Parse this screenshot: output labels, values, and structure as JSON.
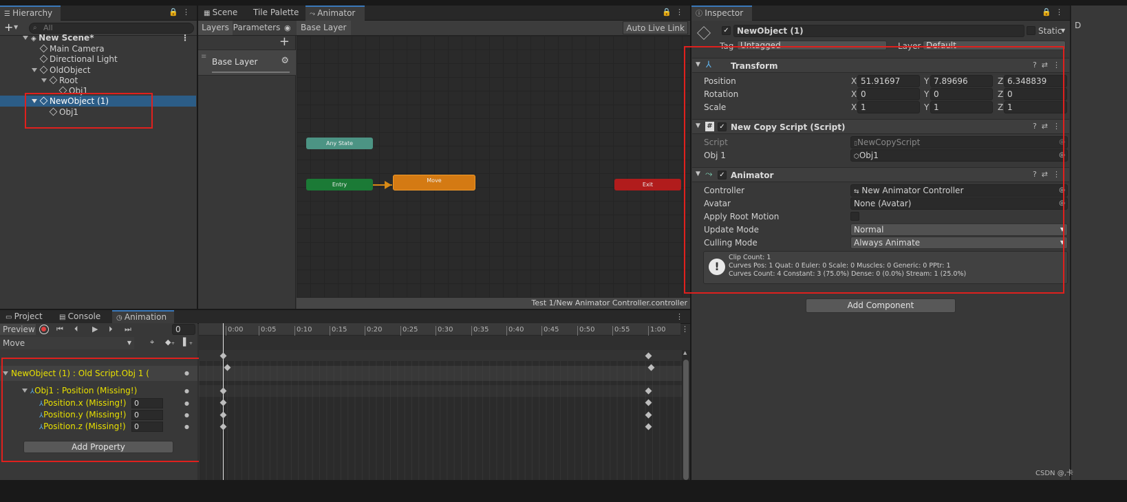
{
  "hierarchy": {
    "tab_label": "Hierarchy",
    "add_label": "+",
    "search_placeholder": "All",
    "items": [
      {
        "label": "New Scene*"
      },
      {
        "label": "Main Camera"
      },
      {
        "label": "Directional Light"
      },
      {
        "label": "OldObject"
      },
      {
        "label": "Root"
      },
      {
        "label": "Obj1"
      },
      {
        "label": "NewObject (1)"
      },
      {
        "label": "Obj1"
      }
    ]
  },
  "center": {
    "tabs": [
      "Scene",
      "Tile Palette",
      "Animator"
    ],
    "layers_tab": "Layers",
    "parameters_tab": "Parameters",
    "breadcrumb": "Base Layer",
    "auto_live_link": "Auto Live Link",
    "layer_item": "Base Layer",
    "nodes": {
      "any_state": "Any State",
      "entry": "Entry",
      "move": "Move",
      "exit": "Exit"
    },
    "status_path": "Test 1/New Animator Controller.controller"
  },
  "inspector": {
    "tab_label": "Inspector",
    "object_name": "NewObject (1)",
    "static_label": "Static",
    "tag_label": "Tag",
    "tag_value": "Untagged",
    "layer_label": "Layer",
    "layer_value": "Default",
    "transform": {
      "title": "Transform",
      "position_label": "Position",
      "rotation_label": "Rotation",
      "scale_label": "Scale",
      "position": {
        "x": "51.91697",
        "y": "7.89696",
        "z": "6.348839"
      },
      "rotation": {
        "x": "0",
        "y": "0",
        "z": "0"
      },
      "scale": {
        "x": "1",
        "y": "1",
        "z": "1"
      },
      "axis_x": "X",
      "axis_y": "Y",
      "axis_z": "Z"
    },
    "copy_script": {
      "title": "New Copy Script (Script)",
      "script_label": "Script",
      "script_value": "NewCopyScript",
      "obj_label": "Obj 1",
      "obj_value": "Obj1"
    },
    "animator": {
      "title": "Animator",
      "controller_label": "Controller",
      "controller_value": "New Animator Controller",
      "avatar_label": "Avatar",
      "avatar_value": "None (Avatar)",
      "root_motion_label": "Apply Root Motion",
      "update_mode_label": "Update Mode",
      "update_mode_value": "Normal",
      "culling_mode_label": "Culling Mode",
      "culling_mode_value": "Always Animate",
      "info_line1": "Clip Count: 1",
      "info_line2": "Curves Pos: 1 Quat: 0 Euler: 0 Scale: 0 Muscles: 0 Generic: 0 PPtr: 1",
      "info_line3": "Curves Count: 4 Constant: 3 (75.0%) Dense: 0 (0.0%) Stream: 1 (25.0%)"
    },
    "add_component": "Add Component"
  },
  "bottom": {
    "tabs": [
      "Project",
      "Console",
      "Animation"
    ],
    "preview": "Preview",
    "frame": "0",
    "clip": "Move",
    "ticks": [
      "0:00",
      "0:05",
      "0:10",
      "0:15",
      "0:20",
      "0:25",
      "0:30",
      "0:35",
      "0:40",
      "0:45",
      "0:50",
      "0:55",
      "1:00"
    ],
    "properties": [
      {
        "label": "NewObject (1) : Old Script.Obj 1 ("
      },
      {
        "label": "Obj1 : Position (Missing!)"
      },
      {
        "label": "Position.x (Missing!)",
        "value": "0"
      },
      {
        "label": "Position.y (Missing!)",
        "value": "0"
      },
      {
        "label": "Position.z (Missing!)",
        "value": "0"
      }
    ],
    "add_property": "Add Property"
  },
  "watermark": "CSDN @,卡",
  "colors": {
    "selection": "#2c5d87",
    "highlight_box": "#e0201d",
    "missing_text": "#e8e000"
  }
}
